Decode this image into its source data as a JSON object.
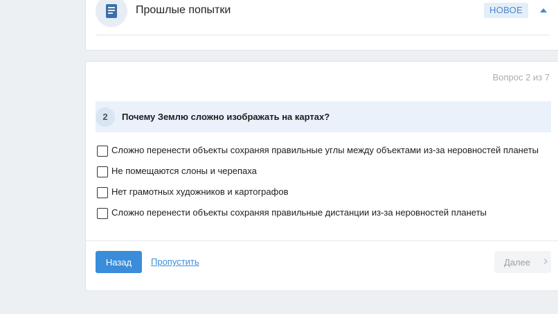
{
  "attempts": {
    "title": "Прошлые попытки",
    "badge": "НОВОЕ",
    "icon": "document-icon",
    "toggle_icon": "chevron-up-icon"
  },
  "question": {
    "counter": "Вопрос 2 из 7",
    "number": "2",
    "text": "Почему Землю сложно изображать на картах?",
    "options": [
      {
        "label": "Сложно перенести объекты сохраняя правильные углы между объектами из-за неровностей планеты",
        "checked": false
      },
      {
        "label": "Не помещаются слоны и черепаха",
        "checked": false
      },
      {
        "label": "Нет грамотных художников и картографов",
        "checked": false
      },
      {
        "label": "Сложно перенести объекты сохраняя правильные дистанции из-за неровностей планеты",
        "checked": false
      }
    ]
  },
  "footer": {
    "back_label": "Назад",
    "skip_label": "Пропустить",
    "next_label": "Далее"
  },
  "colors": {
    "accent": "#3a8ddb",
    "background": "#edf0f3",
    "question_header_bg": "#eaf1fa"
  }
}
